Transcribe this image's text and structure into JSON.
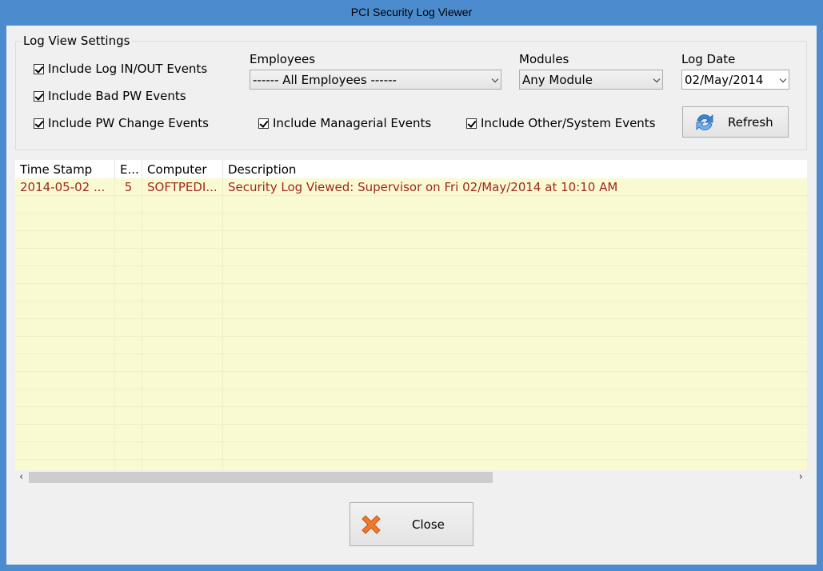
{
  "window": {
    "title": "PCI Security Log Viewer"
  },
  "settings": {
    "legend": "Log View Settings",
    "checks": {
      "log_inout": "Include Log IN/OUT Events",
      "bad_pw": "Include Bad PW Events",
      "pw_change": "Include PW Change Events",
      "managerial": "Include Managerial Events",
      "other_system": "Include Other/System Events"
    },
    "employees_label": "Employees",
    "employees_value": "------ All Employees ------",
    "modules_label": "Modules",
    "modules_value": "Any Module",
    "logdate_label": "Log Date",
    "logdate_value": "02/May/2014",
    "refresh_label": "Refresh"
  },
  "grid": {
    "columns": [
      "Time Stamp",
      "E...",
      "Computer",
      "Description"
    ],
    "rows": [
      [
        "2014-05-02 ...",
        "5",
        "SOFTPEDI...",
        "Security Log Viewed: Supervisor on Fri  02/May/2014 at 10:10 AM"
      ]
    ]
  },
  "footer": {
    "close_label": "Close"
  },
  "colors": {
    "title_bar": "#4b8bce",
    "row_bg": "#fafad2",
    "row_text": "#a0281e"
  },
  "icons": {
    "refresh": "refresh-icon",
    "close": "close-x-icon"
  }
}
